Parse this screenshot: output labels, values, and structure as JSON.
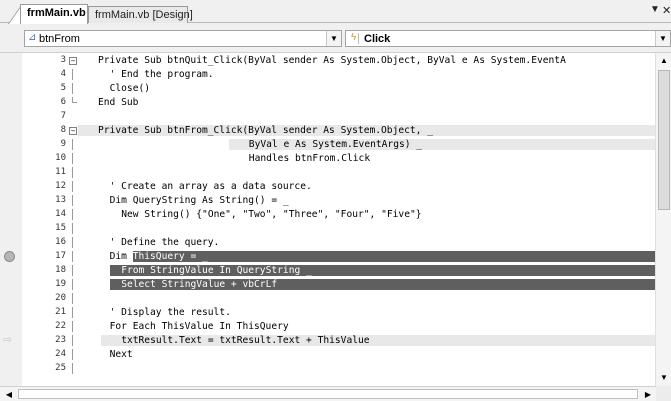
{
  "tabs": [
    {
      "label": "frmMain.vb",
      "active": true
    },
    {
      "label": "frmMain.vb [Design]",
      "active": false
    }
  ],
  "navbar": {
    "object_combo": "btnFrom",
    "object_icon": "class-icon",
    "event_combo": "Click",
    "event_icon": "event-lightning-icon"
  },
  "code_lines": [
    {
      "num": "3",
      "text": "Private Sub btnQuit_Click(ByVal sender As System.Object, ByVal e As System.EventA",
      "indent": 0,
      "fold": "open"
    },
    {
      "num": "4",
      "text": "' End the program.",
      "indent": 2,
      "fold": "line"
    },
    {
      "num": "5",
      "text": "Close()",
      "indent": 2,
      "fold": "line"
    },
    {
      "num": "6",
      "text": "End Sub",
      "indent": 0,
      "fold": "end"
    },
    {
      "num": "7",
      "text": "",
      "indent": 0,
      "fold": ""
    },
    {
      "num": "8",
      "text": "Private Sub btnFrom_Click(ByVal sender As System.Object, _",
      "indent": 0,
      "fold": "open",
      "highlight": "gray"
    },
    {
      "num": "9",
      "text": "ByVal e As System.EventArgs) _",
      "indent": 26,
      "fold": "line",
      "highlight": "gray"
    },
    {
      "num": "10",
      "text": "Handles btnFrom.Click",
      "indent": 26,
      "fold": "line"
    },
    {
      "num": "11",
      "text": "",
      "indent": 0,
      "fold": "line"
    },
    {
      "num": "12",
      "text": "' Create an array as a data source.",
      "indent": 2,
      "fold": "line"
    },
    {
      "num": "13",
      "text": "Dim QueryString As String() = _",
      "indent": 2,
      "fold": "line"
    },
    {
      "num": "14",
      "text": "New String() {\"One\", \"Two\", \"Three\", \"Four\", \"Five\"}",
      "indent": 4,
      "fold": "line"
    },
    {
      "num": "15",
      "text": "",
      "indent": 0,
      "fold": "line"
    },
    {
      "num": "16",
      "text": "' Define the query.",
      "indent": 2,
      "fold": "line"
    },
    {
      "num": "17",
      "text_pre": "Dim ",
      "text": "ThisQuery = _",
      "indent": 2,
      "fold": "line",
      "highlight": "dark",
      "breakpoint": true
    },
    {
      "num": "18",
      "text": "From StringValue In QueryString _",
      "indent": 4,
      "fold": "line",
      "highlight": "dark-full"
    },
    {
      "num": "19",
      "text": "Select StringValue + vbCrLf",
      "indent": 4,
      "fold": "line",
      "highlight": "dark-full"
    },
    {
      "num": "20",
      "text": "",
      "indent": 0,
      "fold": "line"
    },
    {
      "num": "21",
      "text": "' Display the result.",
      "indent": 2,
      "fold": "line"
    },
    {
      "num": "22",
      "text": "For Each ThisValue In ThisQuery",
      "indent": 2,
      "fold": "line"
    },
    {
      "num": "23",
      "text": "txtResult.Text = txtResult.Text + ThisValue",
      "indent": 4,
      "fold": "line",
      "highlight": "gray",
      "current": true
    },
    {
      "num": "24",
      "text": "Next",
      "indent": 2,
      "fold": "line"
    },
    {
      "num": "25",
      "text": "",
      "indent": 0,
      "fold": "line"
    }
  ],
  "colors": {
    "breakpoint_highlight": "#5f5f5f",
    "gray_highlight": "#e8e8e8",
    "margin": "#f0f0f0"
  }
}
